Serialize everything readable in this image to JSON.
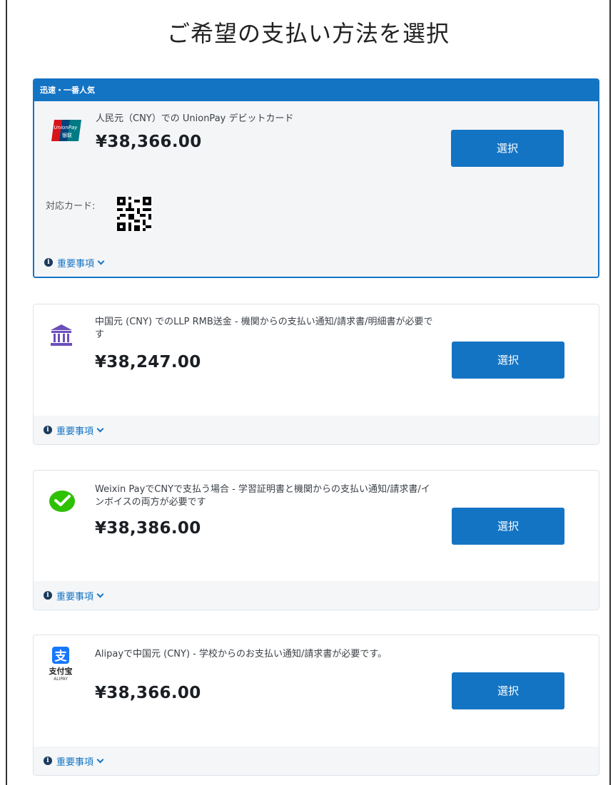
{
  "page": {
    "title": "ご希望の支払い方法を選択"
  },
  "options": [
    {
      "banner": "迅速・一番人気",
      "description": "人民元（CNY）での UnionPay デビットカード",
      "price": "¥38,366.00",
      "select_label": "選択",
      "cards_label": "対応カード:",
      "footer_label": "重要事項",
      "logo": "unionpay-logo",
      "logo_text_top": "UnionPay",
      "logo_text_bottom": "银联"
    },
    {
      "description": "中国元 (CNY) でのLLP RMB送金 - 機関からの支払い通知/請求書/明細書が必要です",
      "price": "¥38,247.00",
      "select_label": "選択",
      "footer_label": "重要事項",
      "logo": "bank-icon"
    },
    {
      "description": "Weixin PayでCNYで支払う場合 - 学習証明書と機関からの支払い通知/請求書/インボイスの両方が必要です",
      "price": "¥38,386.00",
      "select_label": "選択",
      "footer_label": "重要事項",
      "logo": "weixin-pay-icon"
    },
    {
      "description": "Alipayで中国元 (CNY) - 学校からのお支払い通知/請求書が必要です。",
      "price": "¥38,366.00",
      "select_label": "選択",
      "footer_label": "重要事項",
      "logo": "alipay-logo",
      "logo_char": "支",
      "logo_text": "支付宝",
      "logo_subtext": "ALIPAY"
    }
  ],
  "colors": {
    "accent": "#1474c4",
    "wechat": "#2dc100",
    "alipay": "#1677ff",
    "unionpay_red": "#d7141a"
  }
}
